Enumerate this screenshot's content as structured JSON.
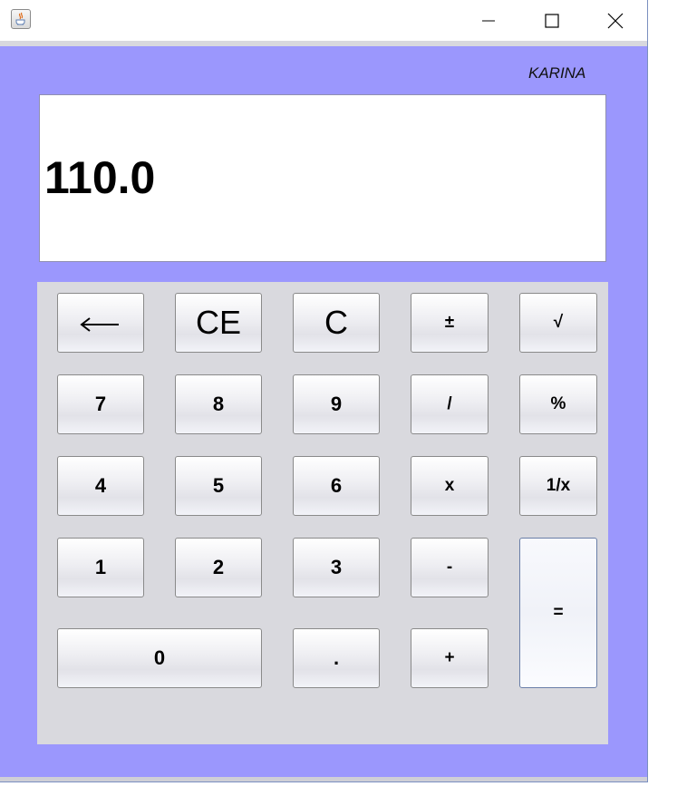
{
  "window": {
    "app_icon": "java-cup-icon",
    "controls": {
      "minimize_icon": "minimize-icon",
      "maximize_icon": "maximize-icon",
      "close_icon": "close-icon"
    }
  },
  "author_label": "KARINA",
  "display": {
    "value": "110.0"
  },
  "keys": {
    "backspace": "⟵",
    "ce": "CE",
    "c": "C",
    "plus_minus": "±",
    "sqrt": "√",
    "seven": "7",
    "eight": "8",
    "nine": "9",
    "divide": "/",
    "percent": "%",
    "four": "4",
    "five": "5",
    "six": "6",
    "multiply": "x",
    "reciprocal": "1/x",
    "one": "1",
    "two": "2",
    "three": "3",
    "minus": "-",
    "equals": "=",
    "zero": "0",
    "decimal": ".",
    "plus": "+"
  },
  "colors": {
    "window_background": "#9b97fd",
    "keypad_background": "#d9d9de",
    "display_background": "#ffffff"
  }
}
